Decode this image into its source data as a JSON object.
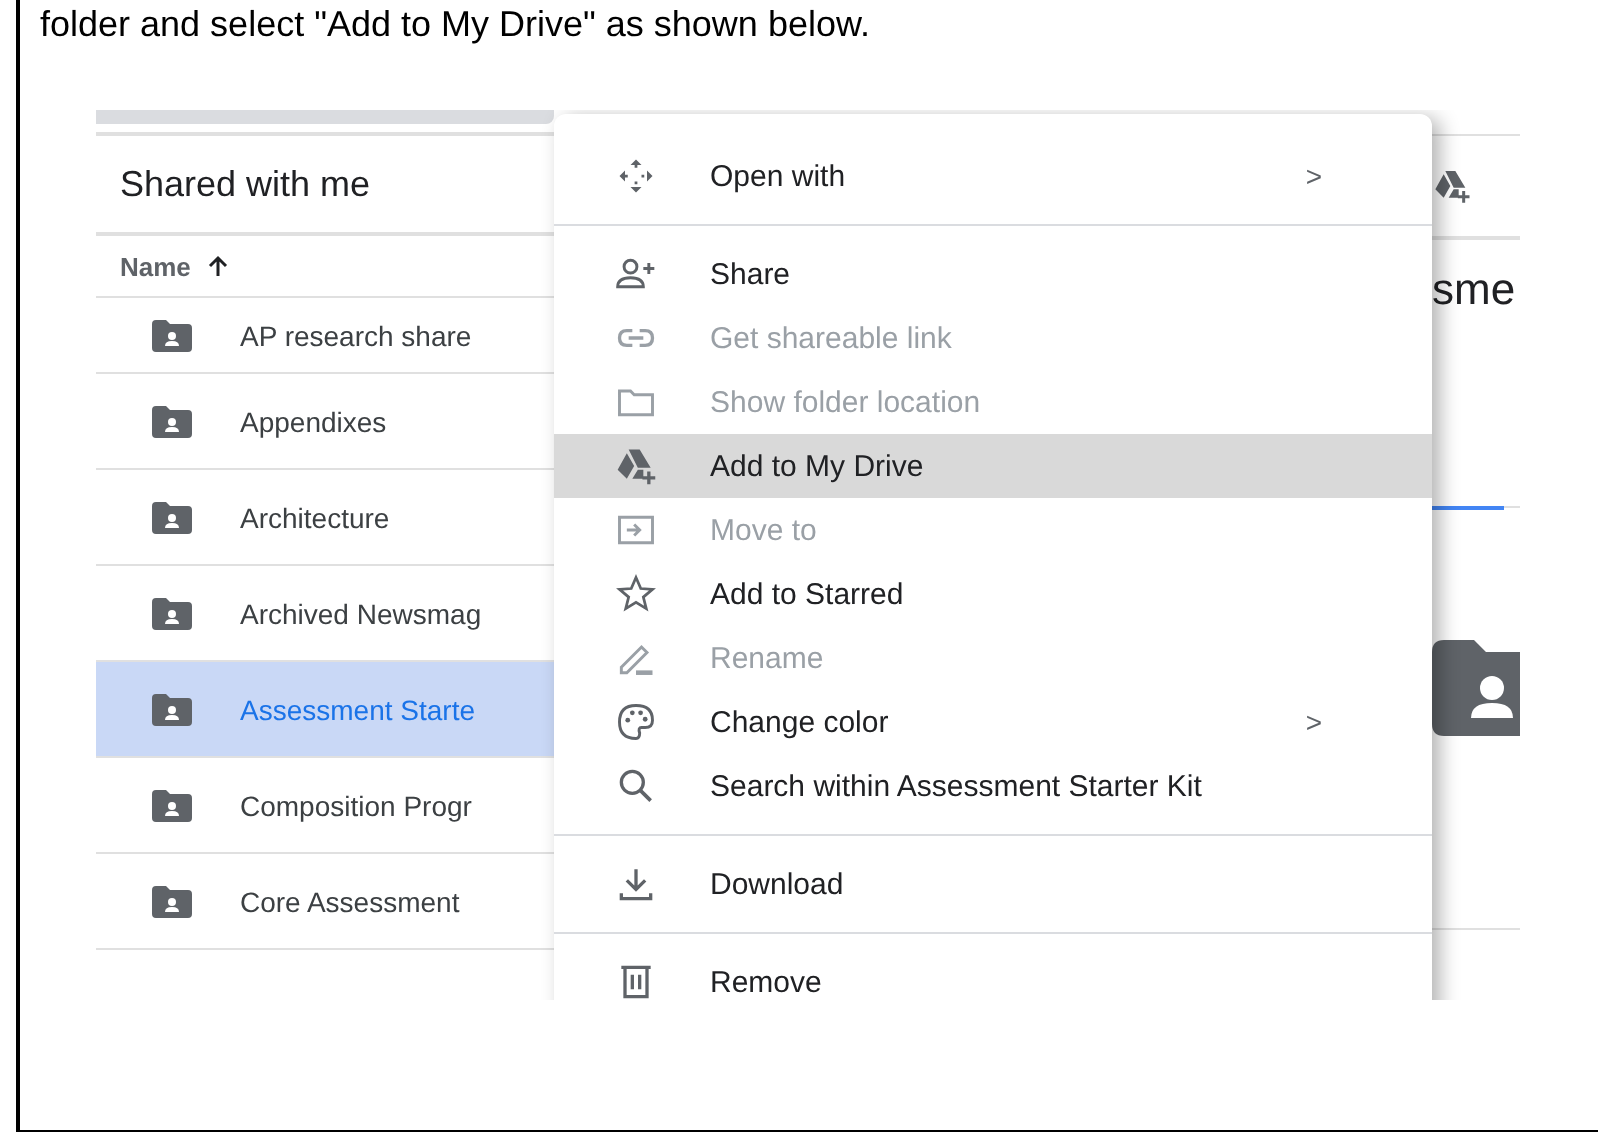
{
  "instruction": "folder and select \"Add to My Drive\" as shown below.",
  "file_list": {
    "title": "Shared with me",
    "sort_column": "Name",
    "rows": [
      {
        "name": "AP research share",
        "selected": false
      },
      {
        "name": "Appendixes",
        "selected": false
      },
      {
        "name": "Architecture",
        "selected": false
      },
      {
        "name": "Archived Newsmag",
        "selected": false
      },
      {
        "name": "Assessment Starte",
        "selected": true
      },
      {
        "name": "Composition Progr",
        "selected": false
      },
      {
        "name": "Core Assessment",
        "selected": false
      }
    ]
  },
  "context_menu": {
    "items": [
      {
        "label": "Open with",
        "disabled": false,
        "highlighted": false,
        "arrow": ">",
        "divider_after": true
      },
      {
        "label": "Share",
        "disabled": false,
        "highlighted": false,
        "divider_after": false
      },
      {
        "label": "Get shareable link",
        "disabled": true,
        "highlighted": false,
        "divider_after": false
      },
      {
        "label": "Show folder location",
        "disabled": true,
        "highlighted": false,
        "divider_after": false
      },
      {
        "label": "Add to My Drive",
        "disabled": false,
        "highlighted": true,
        "divider_after": false
      },
      {
        "label": "Move to",
        "disabled": true,
        "highlighted": false,
        "divider_after": false
      },
      {
        "label": "Add to Starred",
        "disabled": false,
        "highlighted": false,
        "divider_after": false
      },
      {
        "label": "Rename",
        "disabled": true,
        "highlighted": false,
        "divider_after": false
      },
      {
        "label": "Change color",
        "disabled": false,
        "highlighted": false,
        "arrow": ">",
        "divider_after": false
      },
      {
        "label": "Search within Assessment Starter Kit",
        "disabled": false,
        "highlighted": false,
        "divider_after": true
      },
      {
        "label": "Download",
        "disabled": false,
        "highlighted": false,
        "divider_after": true
      },
      {
        "label": "Remove",
        "disabled": false,
        "highlighted": false,
        "divider_after": false
      }
    ]
  },
  "details_panel": {
    "heading": "sme"
  }
}
